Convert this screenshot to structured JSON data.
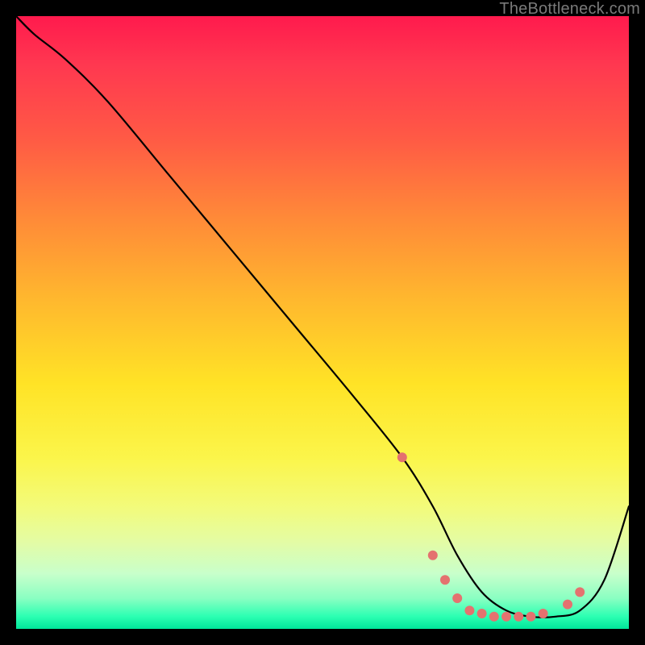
{
  "watermark": "TheBottleneck.com",
  "chart_data": {
    "type": "line",
    "title": "",
    "xlabel": "",
    "ylabel": "",
    "xlim": [
      0,
      100
    ],
    "ylim": [
      0,
      100
    ],
    "grid": false,
    "legend": false,
    "series": [
      {
        "name": "curve",
        "x": [
          0,
          3,
          8,
          15,
          25,
          35,
          45,
          55,
          63,
          68,
          72,
          76,
          80,
          84,
          88,
          92,
          96,
          100
        ],
        "y": [
          100,
          97,
          93,
          86,
          74,
          62,
          50,
          38,
          28,
          20,
          12,
          6,
          3,
          2,
          2,
          3,
          8,
          20
        ]
      }
    ],
    "markers": {
      "series": "curve",
      "color": "#e4726f",
      "radius": 6,
      "points": [
        {
          "x": 63,
          "y": 28
        },
        {
          "x": 68,
          "y": 12
        },
        {
          "x": 70,
          "y": 8
        },
        {
          "x": 72,
          "y": 5
        },
        {
          "x": 74,
          "y": 3
        },
        {
          "x": 76,
          "y": 2.5
        },
        {
          "x": 78,
          "y": 2
        },
        {
          "x": 80,
          "y": 2
        },
        {
          "x": 82,
          "y": 2
        },
        {
          "x": 84,
          "y": 2
        },
        {
          "x": 86,
          "y": 2.5
        },
        {
          "x": 90,
          "y": 4
        },
        {
          "x": 92,
          "y": 6
        }
      ]
    }
  }
}
